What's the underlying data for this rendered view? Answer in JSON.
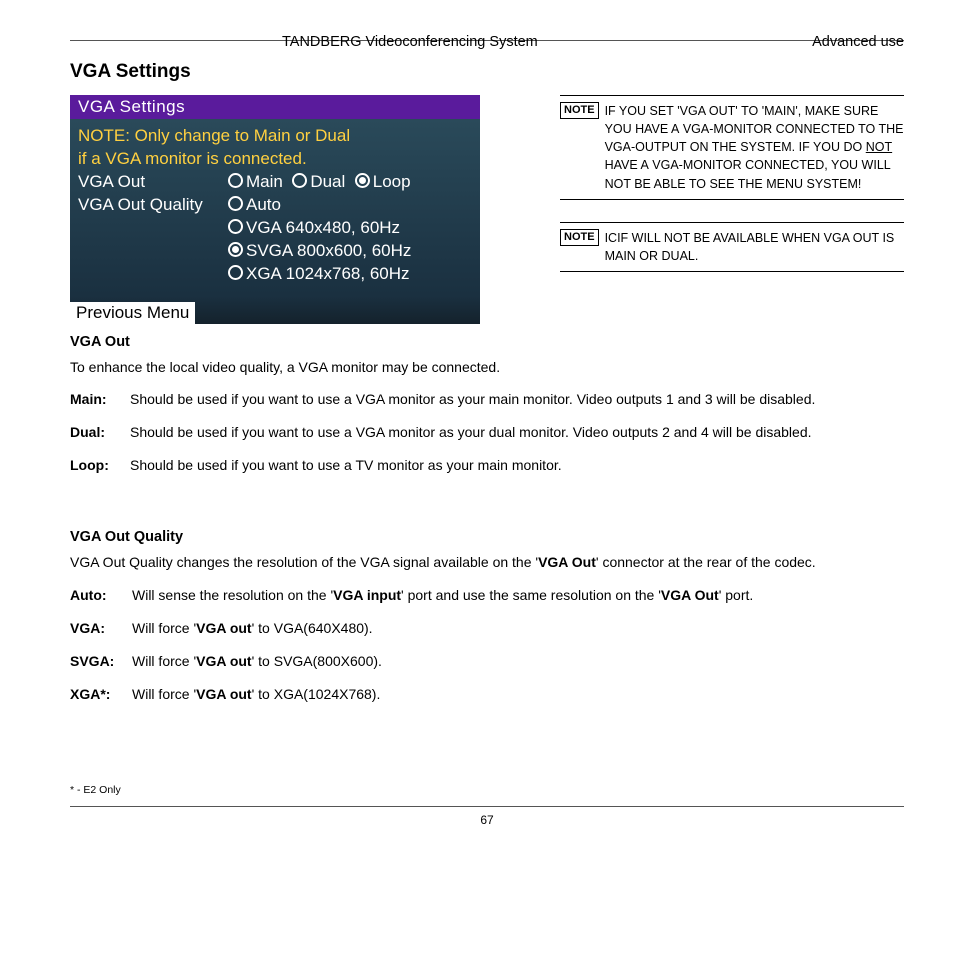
{
  "header": {
    "center": "TANDBERG Videoconferencing System",
    "right": "Advanced use"
  },
  "section_title": "VGA Settings",
  "screenshot": {
    "title": "VGA Settings",
    "note_line1": "NOTE: Only change to Main or Dual",
    "note_line2": "if a VGA monitor is connected.",
    "row1_label": "VGA Out",
    "row1_opts": {
      "main": "Main",
      "dual": "Dual",
      "loop": "Loop"
    },
    "row2_label": "VGA Out Quality",
    "row2_opts": {
      "auto": "Auto",
      "vga": "VGA 640x480, 60Hz",
      "svga": "SVGA 800x600, 60Hz",
      "xga": "XGA 1024x768, 60Hz"
    },
    "previous": "Previous Menu"
  },
  "notes": {
    "label": "NOTE",
    "n1": "If you set 'VGA Out' to 'Main', make sure you have a VGA-monitor connected to the VGA-output on the system. If you do not have a VGA-monitor connected, you will not be able to see the menu system!",
    "n2": "iCIF will not be available when VGA Out is Main or Dual."
  },
  "vga_out": {
    "heading": "VGA Out",
    "intro": "To enhance the local video quality, a VGA monitor may be connected.",
    "main_term": "Main:",
    "main_body": "Should be used if you want to use a VGA monitor as your main monitor. Video outputs 1 and 3 will be disabled.",
    "dual_term": "Dual:",
    "dual_body": "Should be used if you want to use a VGA monitor as your dual monitor. Video outputs 2 and 4 will be disabled.",
    "loop_term": "Loop:",
    "loop_body": "Should be used if you want to use a TV monitor as your main monitor."
  },
  "vga_quality": {
    "heading": "VGA Out Quality",
    "intro_a": "VGA Out Quality changes the resolution of the VGA signal available on the '",
    "intro_b": "VGA Out",
    "intro_c": "' connector at the rear of the codec.",
    "auto_term": "Auto:",
    "auto_a": "Will sense the resolution on the '",
    "auto_b": "VGA input",
    "auto_c": "' port and use the same resolution on the '",
    "auto_d": "VGA Out",
    "auto_e": "' port.",
    "vga_term": "VGA:",
    "vga_a": "Will force '",
    "vga_b": "VGA out",
    "vga_c": "' to VGA(640X480).",
    "svga_term": "SVGA:",
    "svga_a": "Will force '",
    "svga_b": "VGA out",
    "svga_c": "' to SVGA(800X600).",
    "xga_term": "XGA*:",
    "xga_a": "Will force '",
    "xga_b": "VGA out",
    "xga_c": "' to XGA(1024X768)."
  },
  "footnote": "* - E2 Only",
  "page_number": "67"
}
